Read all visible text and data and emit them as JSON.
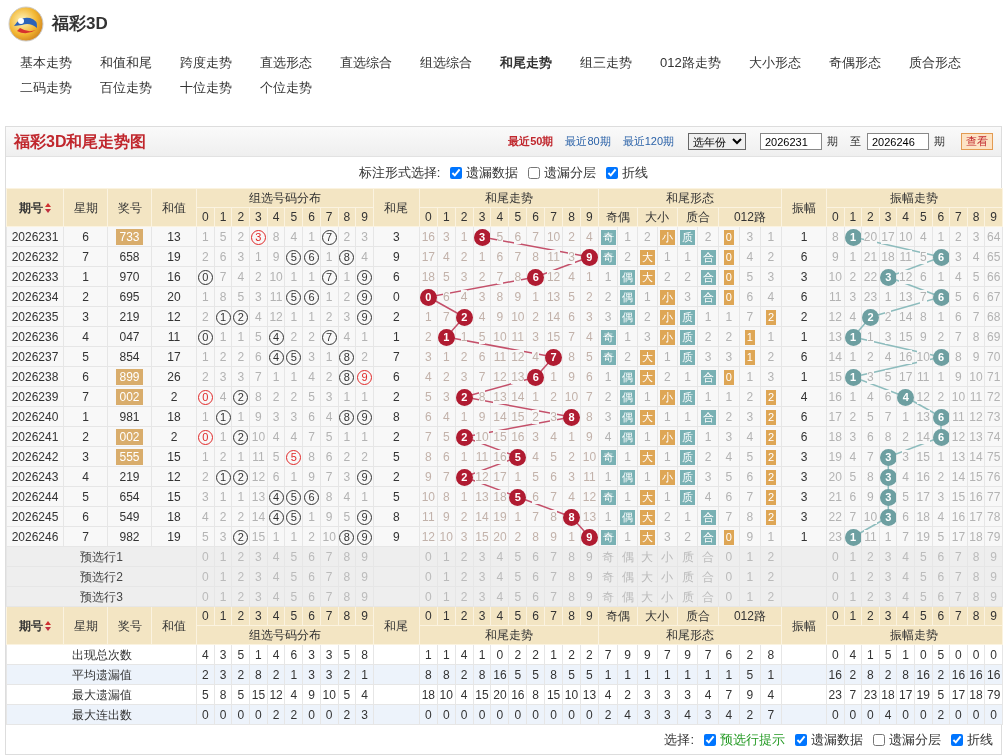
{
  "site": {
    "title": "福彩3D"
  },
  "nav": [
    {
      "label": "基本走势",
      "selected": false
    },
    {
      "label": "和值和尾",
      "selected": false
    },
    {
      "label": "跨度走势",
      "selected": false
    },
    {
      "label": "直选形态",
      "selected": false
    },
    {
      "label": "直选综合",
      "selected": false
    },
    {
      "label": "组选综合",
      "selected": false
    },
    {
      "label": "和尾走势",
      "selected": true
    },
    {
      "label": "组三走势",
      "selected": false
    },
    {
      "label": "012路走势",
      "selected": false
    },
    {
      "label": "大小形态",
      "selected": false
    },
    {
      "label": "奇偶形态",
      "selected": false
    },
    {
      "label": "质合形态",
      "selected": false
    },
    {
      "label": "二码走势",
      "selected": false
    },
    {
      "label": "百位走势",
      "selected": false
    },
    {
      "label": "十位走势",
      "selected": false
    },
    {
      "label": "个位走势",
      "selected": false
    }
  ],
  "panel": {
    "title": "福彩3D和尾走势图",
    "ranges": [
      {
        "label": "最近50期",
        "selected": true
      },
      {
        "label": "最近80期",
        "selected": false
      },
      {
        "label": "最近120期",
        "selected": false
      }
    ],
    "year_select": "选年份",
    "from": "2026231",
    "from_unit": "期",
    "to_label": "至",
    "to": "2026246",
    "to_unit": "期",
    "view_button": "查看"
  },
  "mark_options": {
    "label": "标注形式选择:",
    "items": [
      {
        "label": "遗漏数据",
        "checked": true
      },
      {
        "label": "遗漏分层",
        "checked": false
      },
      {
        "label": "折线",
        "checked": true
      }
    ]
  },
  "columns": {
    "period": "期号",
    "weekday": "星期",
    "number": "奖号",
    "sum": "和值",
    "dist_title": "组选号码分布",
    "dist_digits": [
      "0",
      "1",
      "2",
      "3",
      "4",
      "5",
      "6",
      "7",
      "8",
      "9"
    ],
    "tail": "和尾",
    "trend_title": "和尾走势",
    "trend_digits": [
      "0",
      "1",
      "2",
      "3",
      "4",
      "5",
      "6",
      "7",
      "8",
      "9"
    ],
    "form_title": "和尾形态",
    "form_groups": [
      "奇偶",
      "大小",
      "质合",
      "012路"
    ],
    "amp": "振幅",
    "amp_title": "振幅走势",
    "amp_digits": [
      "0",
      "1",
      "2",
      "3",
      "4",
      "5",
      "6",
      "7",
      "8",
      "9"
    ]
  },
  "rows": [
    {
      "issue": "2026231",
      "weekday": "6",
      "number": "733",
      "highlight": true,
      "sum": "13",
      "dist": [
        "1",
        "5",
        "2",
        "3",
        "8",
        "4",
        "1",
        "7",
        "2",
        "3"
      ],
      "dist_hits": [
        false,
        false,
        false,
        true,
        false,
        false,
        false,
        true,
        false,
        false
      ],
      "dist_pairs": [
        false,
        false,
        false,
        true,
        false,
        false,
        false,
        false,
        false,
        false
      ],
      "tail": "3",
      "trend": [
        "16",
        "3",
        "1",
        "3",
        "5",
        "6",
        "7",
        "10",
        "2",
        "4"
      ],
      "trend_hits": [
        false,
        false,
        false,
        true,
        false,
        false,
        false,
        false,
        false,
        false
      ],
      "form": [
        "奇",
        "1",
        "2",
        "小",
        "质",
        "2",
        "0",
        "3",
        "1"
      ],
      "form_hits": [
        true,
        false,
        false,
        true,
        true,
        false,
        true,
        false,
        false
      ],
      "amplitude": "1",
      "amp_trend": [
        "8",
        "1",
        "20",
        "17",
        "10",
        "4",
        "1",
        "2",
        "3",
        "64"
      ],
      "amp_hits": [
        false,
        true,
        false,
        false,
        false,
        false,
        false,
        false,
        false,
        false
      ]
    },
    {
      "issue": "2026232",
      "weekday": "7",
      "number": "658",
      "highlight": false,
      "sum": "19",
      "dist": [
        "2",
        "6",
        "3",
        "1",
        "9",
        "5",
        "6",
        "1",
        "8",
        "4"
      ],
      "dist_hits": [
        false,
        false,
        false,
        false,
        false,
        true,
        true,
        false,
        true,
        false
      ],
      "dist_pairs": [
        false,
        false,
        false,
        false,
        false,
        false,
        false,
        false,
        false,
        false
      ],
      "tail": "9",
      "trend": [
        "17",
        "4",
        "2",
        "1",
        "6",
        "7",
        "8",
        "11",
        "3",
        "9"
      ],
      "trend_hits": [
        false,
        false,
        false,
        false,
        false,
        false,
        false,
        false,
        false,
        true
      ],
      "form": [
        "奇",
        "2",
        "大",
        "1",
        "1",
        "合",
        "0",
        "4",
        "2"
      ],
      "form_hits": [
        true,
        false,
        true,
        false,
        false,
        true,
        true,
        false,
        false
      ],
      "amplitude": "6",
      "amp_trend": [
        "9",
        "1",
        "21",
        "18",
        "11",
        "5",
        "6",
        "3",
        "4",
        "65"
      ],
      "amp_hits": [
        false,
        false,
        false,
        false,
        false,
        false,
        true,
        false,
        false,
        false
      ]
    },
    {
      "issue": "2026233",
      "weekday": "1",
      "number": "970",
      "highlight": false,
      "sum": "16",
      "dist": [
        "0",
        "7",
        "4",
        "2",
        "10",
        "1",
        "1",
        "7",
        "1",
        "9"
      ],
      "dist_hits": [
        true,
        false,
        false,
        false,
        false,
        false,
        false,
        true,
        false,
        true
      ],
      "dist_pairs": [
        false,
        false,
        false,
        false,
        false,
        false,
        false,
        false,
        false,
        false
      ],
      "tail": "6",
      "trend": [
        "18",
        "5",
        "3",
        "2",
        "7",
        "8",
        "6",
        "12",
        "4",
        "1"
      ],
      "trend_hits": [
        false,
        false,
        false,
        false,
        false,
        false,
        true,
        false,
        false,
        false
      ],
      "form": [
        "1",
        "偶",
        "大",
        "2",
        "2",
        "合",
        "0",
        "5",
        "3"
      ],
      "form_hits": [
        false,
        true,
        true,
        false,
        false,
        true,
        true,
        false,
        false
      ],
      "amplitude": "3",
      "amp_trend": [
        "10",
        "2",
        "22",
        "3",
        "12",
        "6",
        "1",
        "4",
        "5",
        "66"
      ],
      "amp_hits": [
        false,
        false,
        false,
        true,
        false,
        false,
        false,
        false,
        false,
        false
      ]
    },
    {
      "issue": "2026234",
      "weekday": "2",
      "number": "695",
      "highlight": false,
      "sum": "20",
      "dist": [
        "1",
        "8",
        "5",
        "3",
        "11",
        "5",
        "6",
        "1",
        "2",
        "9"
      ],
      "dist_hits": [
        false,
        false,
        false,
        false,
        false,
        true,
        true,
        false,
        false,
        true
      ],
      "dist_pairs": [
        false,
        false,
        false,
        false,
        false,
        false,
        false,
        false,
        false,
        false
      ],
      "tail": "0",
      "trend": [
        "0",
        "6",
        "4",
        "3",
        "8",
        "9",
        "1",
        "13",
        "5",
        "2"
      ],
      "trend_hits": [
        true,
        false,
        false,
        false,
        false,
        false,
        false,
        false,
        false,
        false
      ],
      "form": [
        "2",
        "偶",
        "1",
        "小",
        "3",
        "合",
        "0",
        "6",
        "4"
      ],
      "form_hits": [
        false,
        true,
        false,
        true,
        false,
        true,
        true,
        false,
        false
      ],
      "amplitude": "6",
      "amp_trend": [
        "11",
        "3",
        "23",
        "1",
        "13",
        "7",
        "6",
        "5",
        "6",
        "67"
      ],
      "amp_hits": [
        false,
        false,
        false,
        false,
        false,
        false,
        true,
        false,
        false,
        false
      ]
    },
    {
      "issue": "2026235",
      "weekday": "3",
      "number": "219",
      "highlight": false,
      "sum": "12",
      "dist": [
        "2",
        "1",
        "2",
        "4",
        "12",
        "1",
        "1",
        "2",
        "3",
        "9"
      ],
      "dist_hits": [
        false,
        true,
        true,
        false,
        false,
        false,
        false,
        false,
        false,
        true
      ],
      "dist_pairs": [
        false,
        false,
        false,
        false,
        false,
        false,
        false,
        false,
        false,
        false
      ],
      "tail": "2",
      "trend": [
        "1",
        "7",
        "2",
        "4",
        "9",
        "10",
        "2",
        "14",
        "6",
        "3"
      ],
      "trend_hits": [
        false,
        false,
        true,
        false,
        false,
        false,
        false,
        false,
        false,
        false
      ],
      "form": [
        "3",
        "偶",
        "2",
        "小",
        "质",
        "1",
        "1",
        "7",
        "2"
      ],
      "form_hits": [
        false,
        true,
        false,
        true,
        true,
        false,
        false,
        false,
        true
      ],
      "amplitude": "2",
      "amp_trend": [
        "12",
        "4",
        "2",
        "2",
        "14",
        "8",
        "1",
        "6",
        "7",
        "68"
      ],
      "amp_hits": [
        false,
        false,
        true,
        false,
        false,
        false,
        false,
        false,
        false,
        false
      ]
    },
    {
      "issue": "2026236",
      "weekday": "4",
      "number": "047",
      "highlight": false,
      "sum": "11",
      "dist": [
        "0",
        "1",
        "1",
        "5",
        "4",
        "2",
        "2",
        "7",
        "4",
        "1"
      ],
      "dist_hits": [
        true,
        false,
        false,
        false,
        true,
        false,
        false,
        true,
        false,
        false
      ],
      "dist_pairs": [
        false,
        false,
        false,
        false,
        false,
        false,
        false,
        false,
        false,
        false
      ],
      "tail": "1",
      "trend": [
        "2",
        "1",
        "1",
        "5",
        "10",
        "11",
        "3",
        "15",
        "7",
        "4"
      ],
      "trend_hits": [
        false,
        true,
        false,
        false,
        false,
        false,
        false,
        false,
        false,
        false
      ],
      "form": [
        "奇",
        "1",
        "3",
        "小",
        "质",
        "2",
        "2",
        "1",
        "1"
      ],
      "form_hits": [
        true,
        false,
        false,
        true,
        true,
        false,
        false,
        true,
        false
      ],
      "amplitude": "1",
      "amp_trend": [
        "13",
        "1",
        "1",
        "3",
        "15",
        "9",
        "2",
        "7",
        "8",
        "69"
      ],
      "amp_hits": [
        false,
        true,
        false,
        false,
        false,
        false,
        false,
        false,
        false,
        false
      ]
    },
    {
      "issue": "2026237",
      "weekday": "5",
      "number": "854",
      "highlight": false,
      "sum": "17",
      "dist": [
        "1",
        "2",
        "2",
        "6",
        "4",
        "5",
        "3",
        "1",
        "8",
        "2"
      ],
      "dist_hits": [
        false,
        false,
        false,
        false,
        true,
        true,
        false,
        false,
        true,
        false
      ],
      "dist_pairs": [
        false,
        false,
        false,
        false,
        false,
        false,
        false,
        false,
        false,
        false
      ],
      "tail": "7",
      "trend": [
        "3",
        "1",
        "2",
        "6",
        "11",
        "12",
        "4",
        "7",
        "8",
        "5"
      ],
      "trend_hits": [
        false,
        false,
        false,
        false,
        false,
        false,
        false,
        true,
        false,
        false
      ],
      "form": [
        "奇",
        "2",
        "大",
        "1",
        "质",
        "3",
        "3",
        "1",
        "2"
      ],
      "form_hits": [
        true,
        false,
        true,
        false,
        true,
        false,
        false,
        true,
        false
      ],
      "amplitude": "6",
      "amp_trend": [
        "14",
        "1",
        "2",
        "4",
        "16",
        "10",
        "6",
        "8",
        "9",
        "70"
      ],
      "amp_hits": [
        false,
        false,
        false,
        false,
        false,
        false,
        true,
        false,
        false,
        false
      ]
    },
    {
      "issue": "2026238",
      "weekday": "6",
      "number": "899",
      "highlight": true,
      "sum": "26",
      "dist": [
        "2",
        "3",
        "3",
        "7",
        "1",
        "1",
        "4",
        "2",
        "8",
        "9"
      ],
      "dist_hits": [
        false,
        false,
        false,
        false,
        false,
        false,
        false,
        false,
        true,
        true
      ],
      "dist_pairs": [
        false,
        false,
        false,
        false,
        false,
        false,
        false,
        false,
        false,
        true
      ],
      "tail": "6",
      "trend": [
        "4",
        "2",
        "3",
        "7",
        "12",
        "13",
        "6",
        "1",
        "9",
        "6"
      ],
      "trend_hits": [
        false,
        false,
        false,
        false,
        false,
        false,
        true,
        false,
        false,
        false
      ],
      "form": [
        "1",
        "偶",
        "大",
        "2",
        "1",
        "合",
        "0",
        "1",
        "3"
      ],
      "form_hits": [
        false,
        true,
        true,
        false,
        false,
        true,
        true,
        false,
        false
      ],
      "amplitude": "1",
      "amp_trend": [
        "15",
        "1",
        "3",
        "5",
        "17",
        "11",
        "1",
        "9",
        "10",
        "71"
      ],
      "amp_hits": [
        false,
        true,
        false,
        false,
        false,
        false,
        false,
        false,
        false,
        false
      ]
    },
    {
      "issue": "2026239",
      "weekday": "7",
      "number": "002",
      "highlight": true,
      "sum": "2",
      "dist": [
        "0",
        "4",
        "2",
        "8",
        "2",
        "2",
        "5",
        "3",
        "1",
        "1"
      ],
      "dist_hits": [
        true,
        false,
        true,
        false,
        false,
        false,
        false,
        false,
        false,
        false
      ],
      "dist_pairs": [
        true,
        false,
        false,
        false,
        false,
        false,
        false,
        false,
        false,
        false
      ],
      "tail": "2",
      "trend": [
        "5",
        "3",
        "2",
        "8",
        "13",
        "14",
        "1",
        "2",
        "10",
        "7"
      ],
      "trend_hits": [
        false,
        false,
        true,
        false,
        false,
        false,
        false,
        false,
        false,
        false
      ],
      "form": [
        "2",
        "偶",
        "1",
        "小",
        "质",
        "1",
        "1",
        "2",
        "2"
      ],
      "form_hits": [
        false,
        true,
        false,
        true,
        true,
        false,
        false,
        false,
        true
      ],
      "amplitude": "4",
      "amp_trend": [
        "16",
        "1",
        "4",
        "6",
        "4",
        "12",
        "2",
        "10",
        "11",
        "72"
      ],
      "amp_hits": [
        false,
        false,
        false,
        false,
        true,
        false,
        false,
        false,
        false,
        false
      ]
    },
    {
      "issue": "2026240",
      "weekday": "1",
      "number": "981",
      "highlight": false,
      "sum": "18",
      "dist": [
        "1",
        "1",
        "1",
        "9",
        "3",
        "3",
        "6",
        "4",
        "8",
        "9"
      ],
      "dist_hits": [
        false,
        true,
        false,
        false,
        false,
        false,
        false,
        false,
        true,
        true
      ],
      "dist_pairs": [
        false,
        false,
        false,
        false,
        false,
        false,
        false,
        false,
        false,
        false
      ],
      "tail": "8",
      "trend": [
        "6",
        "4",
        "1",
        "9",
        "14",
        "15",
        "2",
        "3",
        "8",
        "8"
      ],
      "trend_hits": [
        false,
        false,
        false,
        false,
        false,
        false,
        false,
        false,
        true,
        false
      ],
      "form": [
        "3",
        "偶",
        "大",
        "1",
        "1",
        "合",
        "2",
        "3",
        "2"
      ],
      "form_hits": [
        false,
        true,
        true,
        false,
        false,
        true,
        false,
        false,
        true
      ],
      "amplitude": "6",
      "amp_trend": [
        "17",
        "2",
        "5",
        "7",
        "1",
        "13",
        "6",
        "11",
        "12",
        "73"
      ],
      "amp_hits": [
        false,
        false,
        false,
        false,
        false,
        false,
        true,
        false,
        false,
        false
      ]
    },
    {
      "issue": "2026241",
      "weekday": "2",
      "number": "002",
      "highlight": true,
      "sum": "2",
      "dist": [
        "0",
        "1",
        "2",
        "10",
        "4",
        "4",
        "7",
        "5",
        "1",
        "1"
      ],
      "dist_hits": [
        true,
        false,
        true,
        false,
        false,
        false,
        false,
        false,
        false,
        false
      ],
      "dist_pairs": [
        true,
        false,
        false,
        false,
        false,
        false,
        false,
        false,
        false,
        false
      ],
      "tail": "2",
      "trend": [
        "7",
        "5",
        "2",
        "10",
        "15",
        "16",
        "3",
        "4",
        "1",
        "9"
      ],
      "trend_hits": [
        false,
        false,
        true,
        false,
        false,
        false,
        false,
        false,
        false,
        false
      ],
      "form": [
        "4",
        "偶",
        "1",
        "小",
        "质",
        "1",
        "3",
        "4",
        "2"
      ],
      "form_hits": [
        false,
        true,
        false,
        true,
        true,
        false,
        false,
        false,
        true
      ],
      "amplitude": "6",
      "amp_trend": [
        "18",
        "3",
        "6",
        "8",
        "2",
        "14",
        "6",
        "12",
        "13",
        "74"
      ],
      "amp_hits": [
        false,
        false,
        false,
        false,
        false,
        false,
        true,
        false,
        false,
        false
      ]
    },
    {
      "issue": "2026242",
      "weekday": "3",
      "number": "555",
      "highlight": true,
      "sum": "15",
      "dist": [
        "1",
        "2",
        "1",
        "11",
        "5",
        "5",
        "8",
        "6",
        "2",
        "2"
      ],
      "dist_hits": [
        false,
        false,
        false,
        false,
        false,
        true,
        false,
        false,
        false,
        false
      ],
      "dist_pairs": [
        false,
        false,
        false,
        false,
        false,
        true,
        false,
        false,
        false,
        false
      ],
      "tail": "5",
      "trend": [
        "8",
        "6",
        "1",
        "11",
        "16",
        "5",
        "4",
        "5",
        "2",
        "10"
      ],
      "trend_hits": [
        false,
        false,
        false,
        false,
        false,
        true,
        false,
        false,
        false,
        false
      ],
      "form": [
        "奇",
        "1",
        "大",
        "1",
        "质",
        "2",
        "4",
        "5",
        "2"
      ],
      "form_hits": [
        true,
        false,
        true,
        false,
        true,
        false,
        false,
        false,
        true
      ],
      "amplitude": "3",
      "amp_trend": [
        "19",
        "4",
        "7",
        "3",
        "3",
        "15",
        "1",
        "13",
        "14",
        "75"
      ],
      "amp_hits": [
        false,
        false,
        false,
        true,
        false,
        false,
        false,
        false,
        false,
        false
      ]
    },
    {
      "issue": "2026243",
      "weekday": "4",
      "number": "219",
      "highlight": false,
      "sum": "12",
      "dist": [
        "2",
        "1",
        "2",
        "12",
        "6",
        "1",
        "9",
        "7",
        "3",
        "9"
      ],
      "dist_hits": [
        false,
        true,
        true,
        false,
        false,
        false,
        false,
        false,
        false,
        true
      ],
      "dist_pairs": [
        false,
        false,
        false,
        false,
        false,
        false,
        false,
        false,
        false,
        false
      ],
      "tail": "2",
      "trend": [
        "9",
        "7",
        "2",
        "12",
        "17",
        "1",
        "5",
        "6",
        "3",
        "11"
      ],
      "trend_hits": [
        false,
        false,
        true,
        false,
        false,
        false,
        false,
        false,
        false,
        false
      ],
      "form": [
        "1",
        "偶",
        "1",
        "小",
        "质",
        "3",
        "5",
        "6",
        "2"
      ],
      "form_hits": [
        false,
        true,
        false,
        true,
        true,
        false,
        false,
        false,
        true
      ],
      "amplitude": "3",
      "amp_trend": [
        "20",
        "5",
        "8",
        "3",
        "4",
        "16",
        "2",
        "14",
        "15",
        "76"
      ],
      "amp_hits": [
        false,
        false,
        false,
        true,
        false,
        false,
        false,
        false,
        false,
        false
      ]
    },
    {
      "issue": "2026244",
      "weekday": "5",
      "number": "654",
      "highlight": false,
      "sum": "15",
      "dist": [
        "3",
        "1",
        "1",
        "13",
        "4",
        "5",
        "6",
        "8",
        "4",
        "1"
      ],
      "dist_hits": [
        false,
        false,
        false,
        false,
        true,
        true,
        true,
        false,
        false,
        false
      ],
      "dist_pairs": [
        false,
        false,
        false,
        false,
        false,
        false,
        false,
        false,
        false,
        false
      ],
      "tail": "5",
      "trend": [
        "10",
        "8",
        "1",
        "13",
        "18",
        "5",
        "6",
        "7",
        "4",
        "12"
      ],
      "trend_hits": [
        false,
        false,
        false,
        false,
        false,
        true,
        false,
        false,
        false,
        false
      ],
      "form": [
        "奇",
        "1",
        "大",
        "1",
        "质",
        "4",
        "6",
        "7",
        "2"
      ],
      "form_hits": [
        true,
        false,
        true,
        false,
        true,
        false,
        false,
        false,
        true
      ],
      "amplitude": "3",
      "amp_trend": [
        "21",
        "6",
        "9",
        "3",
        "5",
        "17",
        "3",
        "15",
        "16",
        "77"
      ],
      "amp_hits": [
        false,
        false,
        false,
        true,
        false,
        false,
        false,
        false,
        false,
        false
      ]
    },
    {
      "issue": "2026245",
      "weekday": "6",
      "number": "549",
      "highlight": false,
      "sum": "18",
      "dist": [
        "4",
        "2",
        "2",
        "14",
        "4",
        "5",
        "1",
        "9",
        "5",
        "9"
      ],
      "dist_hits": [
        false,
        false,
        false,
        false,
        true,
        true,
        false,
        false,
        false,
        true
      ],
      "dist_pairs": [
        false,
        false,
        false,
        false,
        false,
        false,
        false,
        false,
        false,
        false
      ],
      "tail": "8",
      "trend": [
        "11",
        "9",
        "2",
        "14",
        "19",
        "1",
        "7",
        "8",
        "8",
        "13"
      ],
      "trend_hits": [
        false,
        false,
        false,
        false,
        false,
        false,
        false,
        false,
        true,
        false
      ],
      "form": [
        "1",
        "偶",
        "大",
        "2",
        "1",
        "合",
        "7",
        "8",
        "2"
      ],
      "form_hits": [
        false,
        true,
        true,
        false,
        false,
        true,
        false,
        false,
        true
      ],
      "amplitude": "3",
      "amp_trend": [
        "22",
        "7",
        "10",
        "3",
        "6",
        "18",
        "4",
        "16",
        "17",
        "78"
      ],
      "amp_hits": [
        false,
        false,
        false,
        true,
        false,
        false,
        false,
        false,
        false,
        false
      ]
    },
    {
      "issue": "2026246",
      "weekday": "7",
      "number": "982",
      "highlight": false,
      "sum": "19",
      "dist": [
        "5",
        "3",
        "2",
        "15",
        "1",
        "1",
        "2",
        "10",
        "8",
        "9"
      ],
      "dist_hits": [
        false,
        false,
        true,
        false,
        false,
        false,
        false,
        false,
        true,
        true
      ],
      "dist_pairs": [
        false,
        false,
        false,
        false,
        false,
        false,
        false,
        false,
        false,
        false
      ],
      "tail": "9",
      "trend": [
        "12",
        "10",
        "3",
        "15",
        "20",
        "2",
        "8",
        "9",
        "1",
        "9"
      ],
      "trend_hits": [
        false,
        false,
        false,
        false,
        false,
        false,
        false,
        false,
        false,
        true
      ],
      "form": [
        "奇",
        "1",
        "大",
        "3",
        "2",
        "合",
        "0",
        "9",
        "1"
      ],
      "form_hits": [
        true,
        false,
        true,
        false,
        false,
        true,
        true,
        false,
        false
      ],
      "amplitude": "1",
      "amp_trend": [
        "23",
        "1",
        "11",
        "1",
        "7",
        "19",
        "5",
        "17",
        "18",
        "79"
      ],
      "amp_hits": [
        false,
        true,
        false,
        false,
        false,
        false,
        false,
        false,
        false,
        false
      ]
    }
  ],
  "preselect": [
    {
      "label": "预选行1",
      "dist": [
        "0",
        "1",
        "2",
        "3",
        "4",
        "5",
        "6",
        "7",
        "8",
        "9"
      ],
      "trend": [
        "0",
        "1",
        "2",
        "3",
        "4",
        "5",
        "6",
        "7",
        "8",
        "9"
      ],
      "form": [
        "奇",
        "偶",
        "大",
        "小",
        "质",
        "合",
        "0",
        "1",
        "2"
      ],
      "amp": [
        "0",
        "1",
        "2",
        "3",
        "4",
        "5",
        "6",
        "7",
        "8",
        "9"
      ]
    },
    {
      "label": "预选行2",
      "dist": [
        "0",
        "1",
        "2",
        "3",
        "4",
        "5",
        "6",
        "7",
        "8",
        "9"
      ],
      "trend": [
        "0",
        "1",
        "2",
        "3",
        "4",
        "5",
        "6",
        "7",
        "8",
        "9"
      ],
      "form": [
        "奇",
        "偶",
        "大",
        "小",
        "质",
        "合",
        "0",
        "1",
        "2"
      ],
      "amp": [
        "0",
        "1",
        "2",
        "3",
        "4",
        "5",
        "6",
        "7",
        "8",
        "9"
      ]
    },
    {
      "label": "预选行3",
      "dist": [
        "0",
        "1",
        "2",
        "3",
        "4",
        "5",
        "6",
        "7",
        "8",
        "9"
      ],
      "trend": [
        "0",
        "1",
        "2",
        "3",
        "4",
        "5",
        "6",
        "7",
        "8",
        "9"
      ],
      "form": [
        "奇",
        "偶",
        "大",
        "小",
        "质",
        "合",
        "0",
        "1",
        "2"
      ],
      "amp": [
        "0",
        "1",
        "2",
        "3",
        "4",
        "5",
        "6",
        "7",
        "8",
        "9"
      ]
    }
  ],
  "footer_columns": {
    "period": "期号",
    "weekday": "星期",
    "number": "奖号",
    "sum": "和值",
    "dist_title": "组选号码分布",
    "dist_digits": [
      "0",
      "1",
      "2",
      "3",
      "4",
      "5",
      "6",
      "7",
      "8",
      "9"
    ],
    "tail": "和尾",
    "trend_title": "和尾走势",
    "trend_digits": [
      "0",
      "1",
      "2",
      "3",
      "4",
      "5",
      "6",
      "7",
      "8",
      "9"
    ],
    "form_title": "和尾形态",
    "form_groups": [
      "奇偶",
      "大小",
      "质合",
      "012路"
    ],
    "amp": "振幅",
    "amp_title": "振幅走势",
    "amp_digits": [
      "0",
      "1",
      "2",
      "3",
      "4",
      "5",
      "6",
      "7",
      "8",
      "9"
    ]
  },
  "stats": [
    {
      "label": "出现总次数",
      "dist": [
        "4",
        "3",
        "5",
        "1",
        "4",
        "6",
        "3",
        "3",
        "5",
        "8"
      ],
      "trend": [
        "1",
        "1",
        "4",
        "1",
        "0",
        "2",
        "2",
        "1",
        "2",
        "2"
      ],
      "form": [
        "7",
        "9",
        "9",
        "7",
        "9",
        "7",
        "6",
        "2",
        "8"
      ],
      "amp": [
        "0",
        "4",
        "1",
        "5",
        "1",
        "0",
        "5",
        "0",
        "0",
        "0"
      ]
    },
    {
      "label": "平均遗漏值",
      "dist": [
        "2",
        "3",
        "2",
        "8",
        "2",
        "1",
        "3",
        "3",
        "2",
        "1"
      ],
      "trend": [
        "8",
        "8",
        "2",
        "8",
        "16",
        "5",
        "5",
        "8",
        "5",
        "5"
      ],
      "form": [
        "1",
        "1",
        "1",
        "1",
        "1",
        "1",
        "1",
        "5",
        "1"
      ],
      "amp": [
        "16",
        "2",
        "8",
        "2",
        "8",
        "16",
        "2",
        "16",
        "16",
        "16"
      ]
    },
    {
      "label": "最大遗漏值",
      "dist": [
        "5",
        "8",
        "5",
        "15",
        "12",
        "4",
        "9",
        "10",
        "5",
        "4"
      ],
      "trend": [
        "18",
        "10",
        "4",
        "15",
        "20",
        "16",
        "8",
        "15",
        "10",
        "13"
      ],
      "form": [
        "4",
        "2",
        "3",
        "3",
        "3",
        "4",
        "7",
        "9",
        "4"
      ],
      "amp": [
        "23",
        "7",
        "23",
        "18",
        "17",
        "19",
        "5",
        "17",
        "18",
        "79"
      ]
    },
    {
      "label": "最大连出数",
      "dist": [
        "0",
        "0",
        "0",
        "0",
        "2",
        "2",
        "0",
        "0",
        "2",
        "3"
      ],
      "trend": [
        "0",
        "0",
        "0",
        "0",
        "0",
        "0",
        "0",
        "0",
        "0",
        "0"
      ],
      "form": [
        "2",
        "4",
        "3",
        "3",
        "4",
        "3",
        "4",
        "2",
        "7"
      ],
      "amp": [
        "0",
        "0",
        "0",
        "4",
        "0",
        "0",
        "2",
        "0",
        "0",
        "0"
      ]
    }
  ],
  "footer_options": {
    "label": "选择:",
    "items": [
      {
        "label": "预选行提示",
        "checked": true,
        "emphasis": true
      },
      {
        "label": "遗漏数据",
        "checked": true,
        "emphasis": false
      },
      {
        "label": "遗漏分层",
        "checked": false,
        "emphasis": false
      },
      {
        "label": "折线",
        "checked": true,
        "emphasis": false
      }
    ]
  }
}
